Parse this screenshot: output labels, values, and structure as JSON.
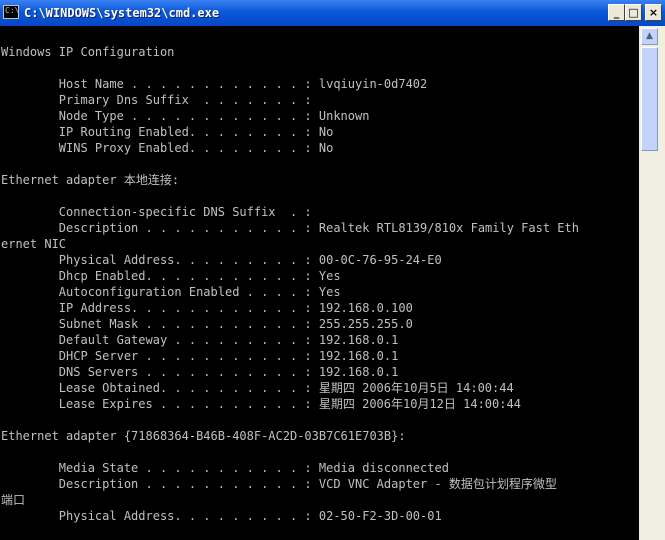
{
  "window": {
    "title": "C:\\WINDOWS\\system32\\cmd.exe",
    "icon": "cmd-icon",
    "buttons": {
      "minimize": "_",
      "maximize": "□",
      "close": "×"
    }
  },
  "scrollbar": {
    "up_arrow": "▲"
  },
  "console": {
    "lines": [
      "",
      "Windows IP Configuration",
      "",
      "        Host Name . . . . . . . . . . . . : lvqiuyin-0d7402",
      "        Primary Dns Suffix  . . . . . . . :",
      "        Node Type . . . . . . . . . . . . : Unknown",
      "        IP Routing Enabled. . . . . . . . : No",
      "        WINS Proxy Enabled. . . . . . . . : No",
      "",
      "Ethernet adapter 本地连接:",
      "",
      "        Connection-specific DNS Suffix  . :",
      "        Description . . . . . . . . . . . : Realtek RTL8139/810x Family Fast Eth",
      "ernet NIC",
      "        Physical Address. . . . . . . . . : 00-0C-76-95-24-E0",
      "        Dhcp Enabled. . . . . . . . . . . : Yes",
      "        Autoconfiguration Enabled . . . . : Yes",
      "        IP Address. . . . . . . . . . . . : 192.168.0.100",
      "        Subnet Mask . . . . . . . . . . . : 255.255.255.0",
      "        Default Gateway . . . . . . . . . : 192.168.0.1",
      "        DHCP Server . . . . . . . . . . . : 192.168.0.1",
      "        DNS Servers . . . . . . . . . . . : 192.168.0.1",
      "        Lease Obtained. . . . . . . . . . : 星期四 2006年10月5日 14:00:44",
      "        Lease Expires . . . . . . . . . . : 星期四 2006年10月12日 14:00:44",
      "",
      "Ethernet adapter {71868364-B46B-408F-AC2D-03B7C61E703B}:",
      "",
      "        Media State . . . . . . . . . . . : Media disconnected",
      "        Description . . . . . . . . . . . : VCD VNC Adapter - 数据包计划程序微型",
      "端口",
      "        Physical Address. . . . . . . . . : 02-50-F2-3D-00-01"
    ]
  }
}
